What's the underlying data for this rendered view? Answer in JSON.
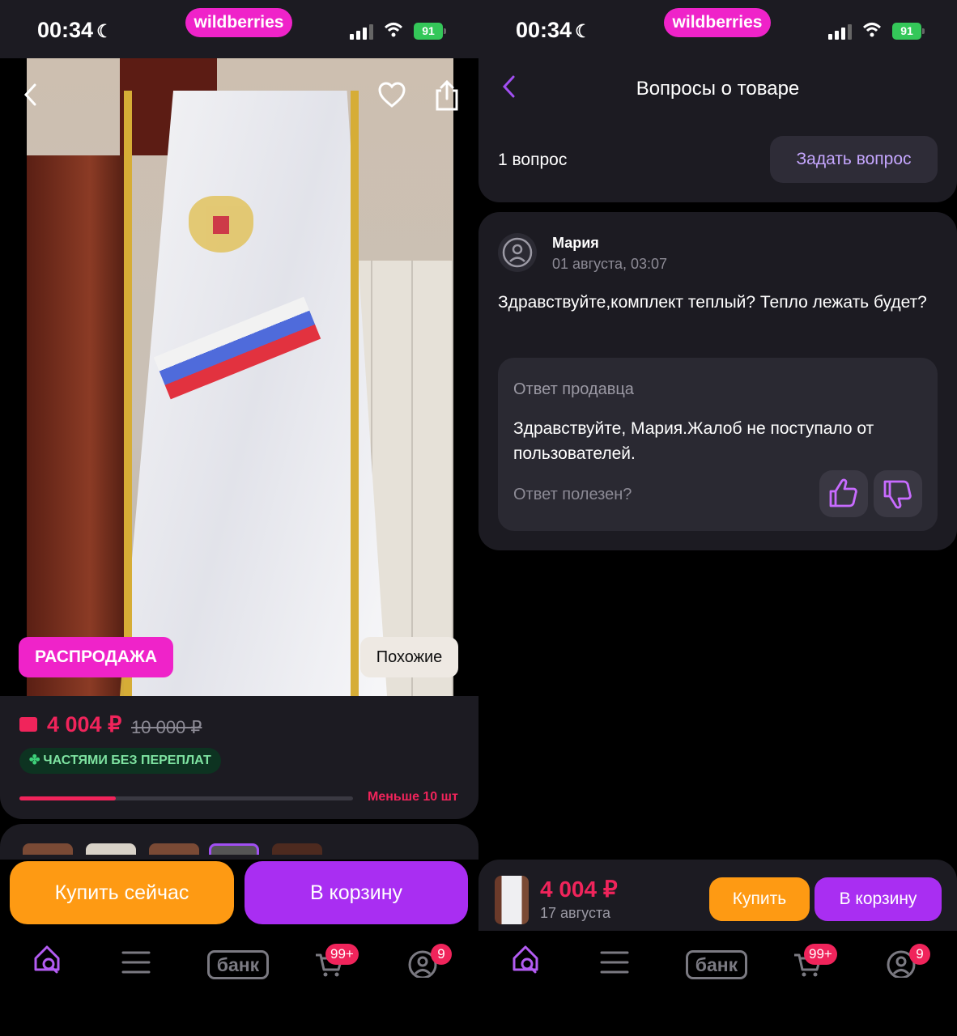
{
  "status_bar": {
    "time": "00:34",
    "brand": "wildberries",
    "battery": "91"
  },
  "product": {
    "sale_badge": "РАСПРОДАЖА",
    "similar_button": "Похожие",
    "price": "4 004 ₽",
    "old_price": "10 000 ₽",
    "installment": "ЧАСТЯМИ БЕЗ ПЕРЕПЛАТ",
    "stock_label": "Меньше 10 шт",
    "stock_fraction": 0.29,
    "buy_now_button": "Купить сейчас",
    "to_cart_button": "В корзину"
  },
  "tabbar": {
    "bank_label": "банк",
    "cart_badge": "99+",
    "profile_badge": "9"
  },
  "questions": {
    "title": "Вопросы о товаре",
    "count_label": "1 вопрос",
    "ask_button": "Задать вопрос",
    "item": {
      "author": "Мария",
      "date": "01 августа, 03:07",
      "text": "Здравствуйте,комплект теплый? Тепло лежать будет?",
      "answer_title": "Ответ продавца",
      "answer_text": "Здравствуйте, Мария.Жалоб не поступало от пользователей.",
      "helpful_label": "Ответ полезен?"
    },
    "bottom": {
      "price": "4 004 ₽",
      "delivery_date": "17 августа",
      "buy_button": "Купить",
      "cart_button": "В корзину"
    }
  },
  "colors": {
    "accent_pink": "#ef23c9",
    "accent_purple": "#a92ef2",
    "orange": "#fe9a13",
    "price_red": "#f0245b"
  }
}
